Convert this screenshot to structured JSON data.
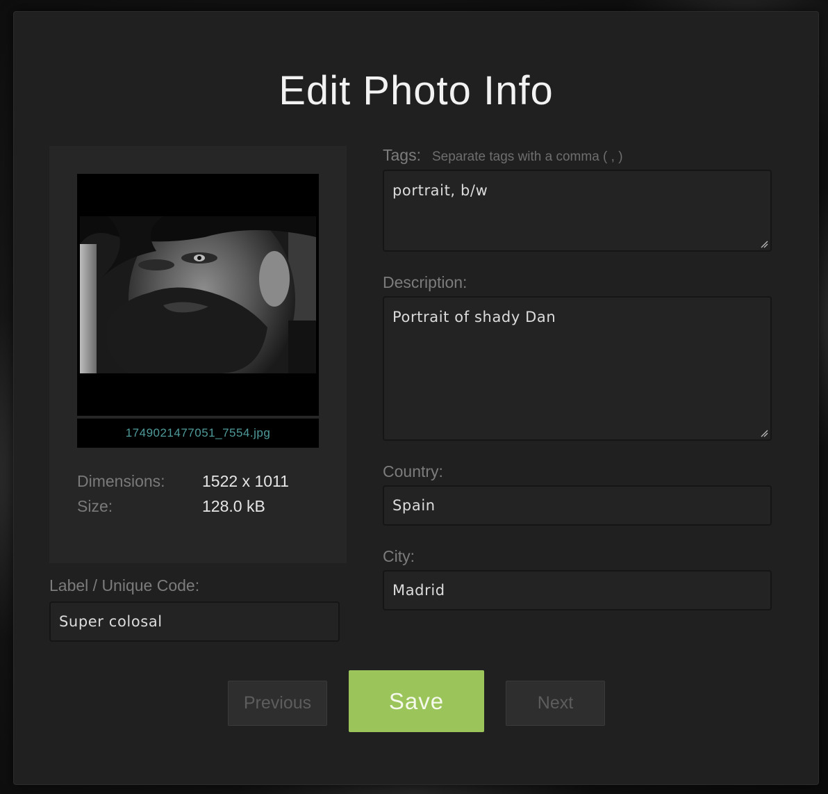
{
  "dialog": {
    "title": "Edit Photo Info"
  },
  "preview": {
    "filename": "1749021477051_7554.jpg",
    "photo_alt": "Black and white portrait of a bearded man",
    "meta": [
      {
        "key": "Dimensions:",
        "value": "1522 x 1011"
      },
      {
        "key": "Size:",
        "value": "128.0 kB"
      }
    ]
  },
  "label_field": {
    "label": "Label / Unique Code:",
    "value": "Super colosal"
  },
  "tags_field": {
    "label": "Tags:",
    "hint": "Separate tags with a comma ( , )",
    "value": "portrait, b/w"
  },
  "description_field": {
    "label": "Description:",
    "value": "Portrait of shady Dan"
  },
  "country_field": {
    "label": "Country:",
    "value": "Spain"
  },
  "city_field": {
    "label": "City:",
    "value": "Madrid"
  },
  "buttons": {
    "previous": "Previous",
    "save": "Save",
    "next": "Next"
  },
  "colors": {
    "accent_save": "#9bc45a",
    "filename_text": "#4f9a9a",
    "modal_bg": "#202020"
  }
}
